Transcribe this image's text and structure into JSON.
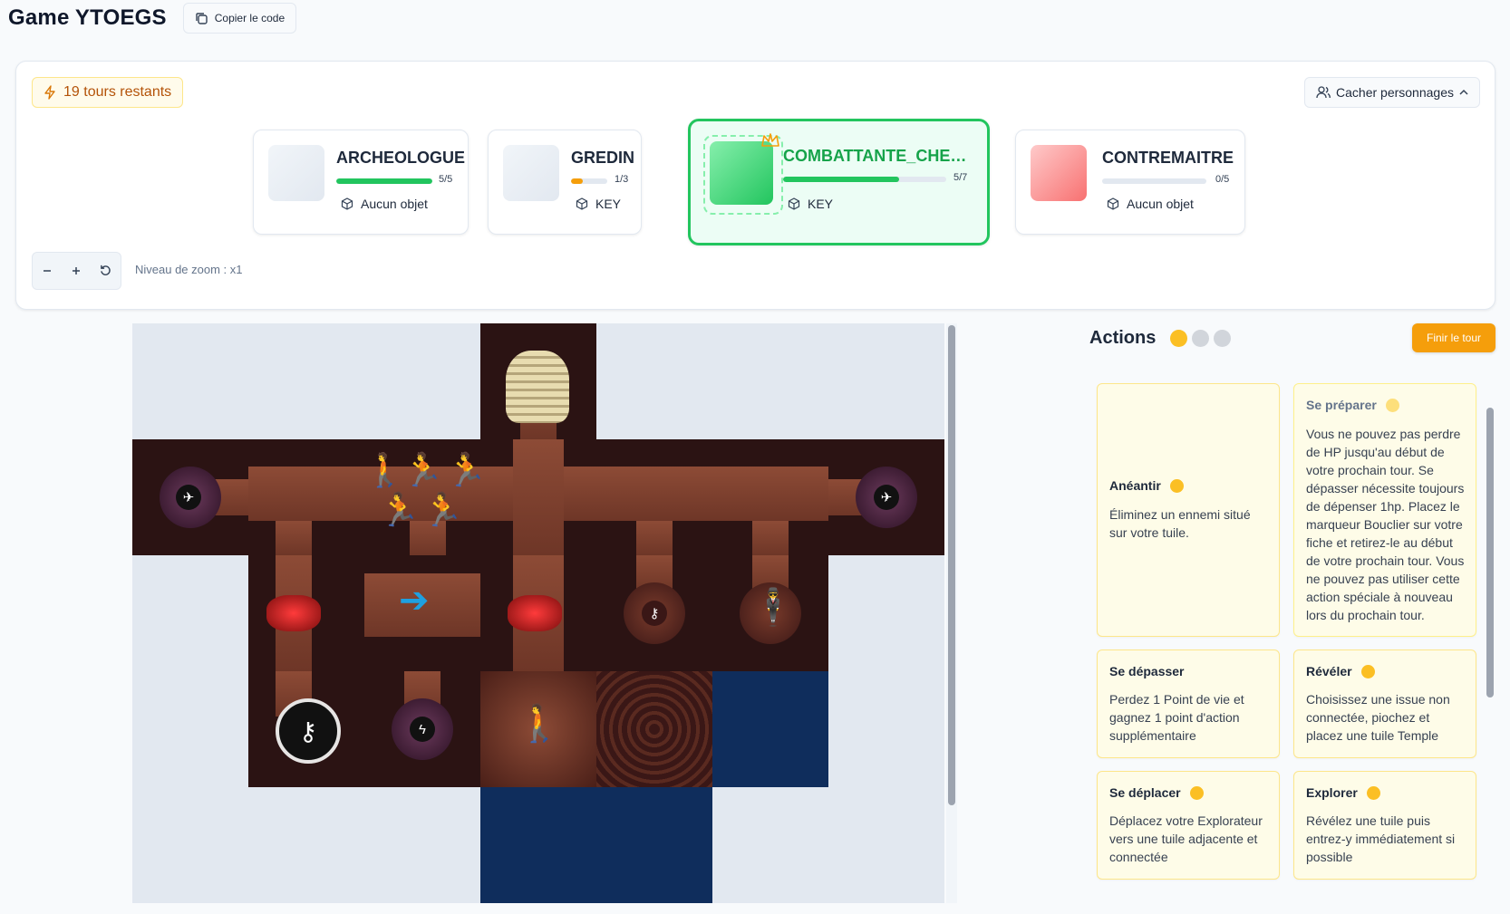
{
  "header": {
    "title": "Game YTOEGS",
    "copy_label": "Copier le code"
  },
  "panel": {
    "turns_label": "19 tours restants",
    "hide_label": "Cacher personnages",
    "zoom_label": "Niveau de zoom : x1"
  },
  "characters": [
    {
      "name": "ARCHEOLOGUE",
      "hp": "5/5",
      "hp_fraction": 1.0,
      "hp_color": "#22c55e",
      "item": "Aucun objet",
      "active": false
    },
    {
      "name": "GREDIN",
      "hp": "1/3",
      "hp_fraction": 0.33,
      "hp_color": "#f59e0b",
      "item": "KEY",
      "active": false
    },
    {
      "name": "COMBATTANTE_CHE…",
      "hp": "5/7",
      "hp_fraction": 0.71,
      "hp_color": "#22c55e",
      "item": "KEY",
      "active": true
    },
    {
      "name": "CONTREMAITRE",
      "hp": "0/5",
      "hp_fraction": 0,
      "hp_color": "#22c55e",
      "item": "Aucun objet",
      "active": false
    }
  ],
  "actions": {
    "title": "Actions",
    "end_turn_label": "Finir le tour",
    "points_total": 3,
    "points_available": 1,
    "list": [
      {
        "name": "Anéantir",
        "desc": "Éliminez un ennemi situé sur votre tuile."
      },
      {
        "name": "Se préparer",
        "desc": "Vous ne pouvez pas perdre de HP jusqu'au début de votre prochain tour. Se dépasser nécessite toujours de dépenser 1hp. Placez le marqueur Bouclier sur votre fiche et retirez-le au début de votre prochain tour. Vous ne pouvez pas utiliser cette action spéciale à nouveau lors du prochain tour."
      },
      {
        "name": "Se dépasser",
        "desc": "Perdez 1 Point de vie et gagnez 1 point d'action supplémentaire"
      },
      {
        "name": "Révéler",
        "desc": "Choisissez une issue non connectée, piochez et placez une tuile Temple"
      },
      {
        "name": "Se déplacer",
        "desc": "Déplacez votre Explorateur vers une tuile adjacente et connectée"
      },
      {
        "name": "Explorer",
        "desc": "Révélez une tuile puis entrez-y immédiatement si possible"
      }
    ]
  },
  "icons": [
    "copy-icon",
    "lightning-icon",
    "users-icon",
    "chevron-up-icon",
    "box-icon",
    "crown-icon",
    "minus-icon",
    "plus-icon",
    "reset-icon"
  ]
}
